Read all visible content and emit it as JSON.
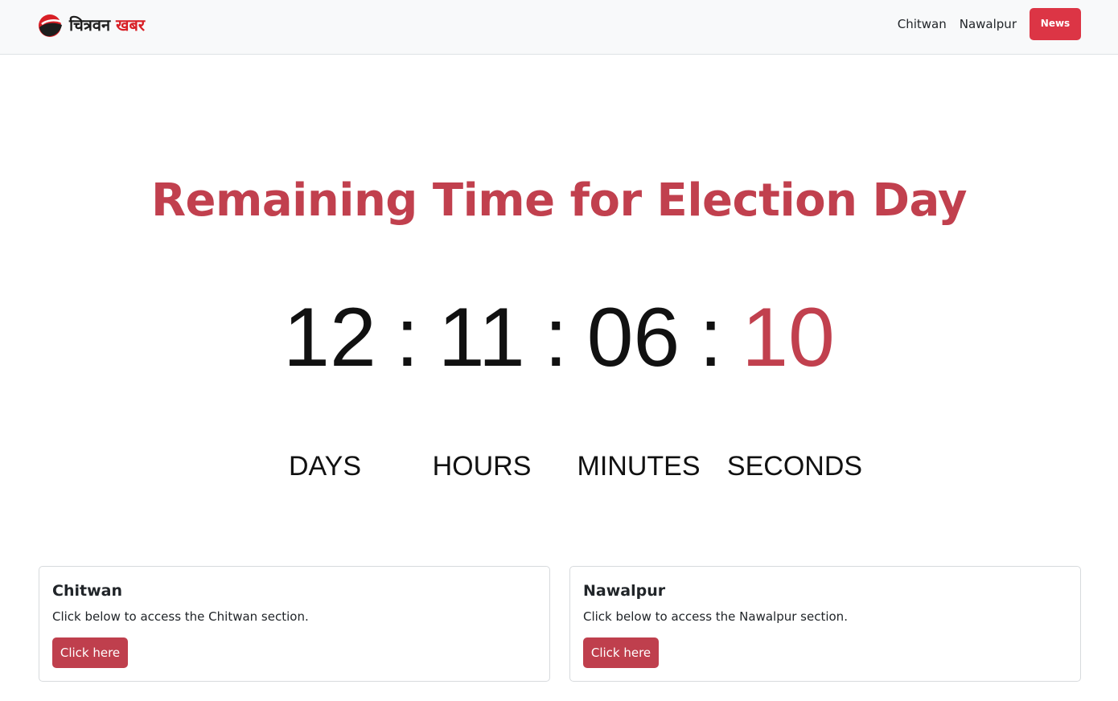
{
  "navbar": {
    "brand": {
      "part1": "चित्रवन",
      "part2": "खबर",
      "icon": "brand-logo-icon"
    },
    "links": [
      "Chitwan",
      "Nawalpur"
    ],
    "news_button": "News"
  },
  "hero": {
    "title": "Remaining Time for Election Day"
  },
  "countdown": {
    "days": "12",
    "hours": "11",
    "minutes": "06",
    "seconds": "10",
    "separator": ":",
    "labels": {
      "days": "DAYS",
      "hours": "HOURS",
      "minutes": "MINUTES",
      "seconds": "SECONDS"
    }
  },
  "cards": [
    {
      "title": "Chitwan",
      "text": "Click below to access the Chitwan section.",
      "button": "Click here"
    },
    {
      "title": "Nawalpur",
      "text": "Click below to access the Nawalpur section.",
      "button": "Click here"
    }
  ],
  "colors": {
    "accent": "#c1404e",
    "news_button": "#dc3545",
    "brand_red": "#d81f26",
    "navbar_bg": "#f8f9fa"
  }
}
